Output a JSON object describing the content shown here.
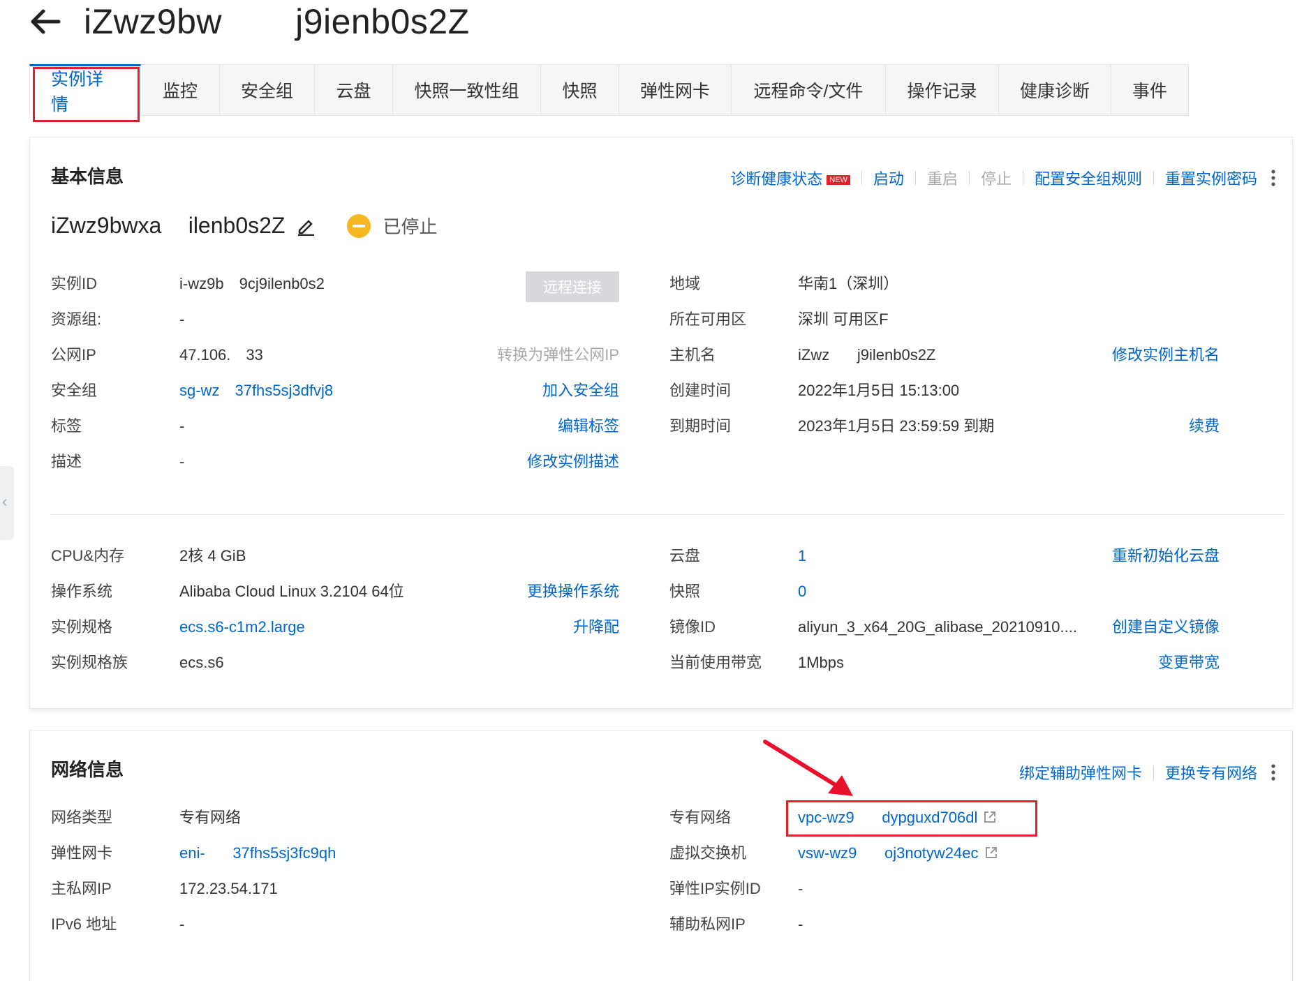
{
  "header": {
    "title": "iZwz9bw          j9ienb0s2Z"
  },
  "tabs": [
    {
      "label": "实例详情",
      "active": true
    },
    {
      "label": "监控"
    },
    {
      "label": "安全组"
    },
    {
      "label": "云盘"
    },
    {
      "label": "快照一致性组"
    },
    {
      "label": "快照"
    },
    {
      "label": "弹性网卡"
    },
    {
      "label": "远程命令/文件"
    },
    {
      "label": "操作记录"
    },
    {
      "label": "健康诊断"
    },
    {
      "label": "事件"
    }
  ],
  "basic": {
    "title": "基本信息",
    "actions": {
      "diagnose": "诊断健康状态",
      "new_badge": "NEW",
      "start": "启动",
      "restart": "重启",
      "stop": "停止",
      "config_sg": "配置安全组规则",
      "reset_pwd": "重置实例密码"
    },
    "instance_name": "iZwz9bwxa      ilenb0s2Z",
    "status": "已停止",
    "remote_connect": "远程连接",
    "left": [
      {
        "label": "实例ID",
        "value": "i-wz9b     9cj9ilenb0s2",
        "action": ""
      },
      {
        "label": "资源组:",
        "value": "-",
        "action": ""
      },
      {
        "label": "公网IP",
        "value": "47.106.     33",
        "action": "转换为弹性公网IP"
      },
      {
        "label": "安全组",
        "value": "sg-wz     37fhs5sj3dfvj8",
        "action": "加入安全组"
      },
      {
        "label": "标签",
        "value": "-",
        "action": "编辑标签"
      },
      {
        "label": "描述",
        "value": "-",
        "action": "修改实例描述"
      }
    ],
    "right": [
      {
        "label": "地域",
        "value": "华南1（深圳）",
        "action": ""
      },
      {
        "label": "所在可用区",
        "value": "深圳 可用区F",
        "action": ""
      },
      {
        "label": "主机名",
        "value": "iZwz         j9ilenb0s2Z",
        "action": "修改实例主机名"
      },
      {
        "label": "创建时间",
        "value": "2022年1月5日 15:13:00",
        "action": ""
      },
      {
        "label": "到期时间",
        "value": "2023年1月5日 23:59:59 到期",
        "action": "续费"
      }
    ],
    "left2": [
      {
        "label": "CPU&内存",
        "value": "2核 4 GiB",
        "action": ""
      },
      {
        "label": "操作系统",
        "value": "Alibaba Cloud Linux 3.2104 64位",
        "action": "更换操作系统"
      },
      {
        "label": "实例规格",
        "value": "ecs.s6-c1m2.large",
        "action": "升降配"
      },
      {
        "label": "实例规格族",
        "value": "ecs.s6",
        "action": ""
      }
    ],
    "right2": [
      {
        "label": "云盘",
        "value": "1",
        "action": "重新初始化云盘"
      },
      {
        "label": "快照",
        "value": "0",
        "action": ""
      },
      {
        "label": "镜像ID",
        "value": "aliyun_3_x64_20G_alibase_20210910....",
        "action": "创建自定义镜像"
      },
      {
        "label": "当前使用带宽",
        "value": "1Mbps",
        "action": "变更带宽"
      }
    ]
  },
  "network": {
    "title": "网络信息",
    "actions": {
      "bind_eni": "绑定辅助弹性网卡",
      "change_vpc": "更换专有网络"
    },
    "left": [
      {
        "label": "网络类型",
        "value": "专有网络"
      },
      {
        "label": "弹性网卡",
        "value": "eni-         37fhs5sj3fc9qh"
      },
      {
        "label": "主私网IP",
        "value": "172.23.54.171"
      },
      {
        "label": "IPv6 地址",
        "value": "-"
      }
    ],
    "right": [
      {
        "label": "专有网络",
        "value": "vpc-wz9         dypguxd706dl"
      },
      {
        "label": "虚拟交换机",
        "value": "vsw-wz9         oj3notyw24ec"
      },
      {
        "label": "弹性IP实例ID",
        "value": "-"
      },
      {
        "label": "辅助私网IP",
        "value": "-"
      }
    ]
  },
  "colors": {
    "link": "#0066cc",
    "highlight": "#e0202a",
    "status_stopped": "#f5b823"
  },
  "icons": {
    "back": "arrow-left-icon",
    "edit": "pencil-icon",
    "status": "stopped-circle-icon",
    "external": "external-link-icon",
    "more": "more-vertical-icon"
  }
}
